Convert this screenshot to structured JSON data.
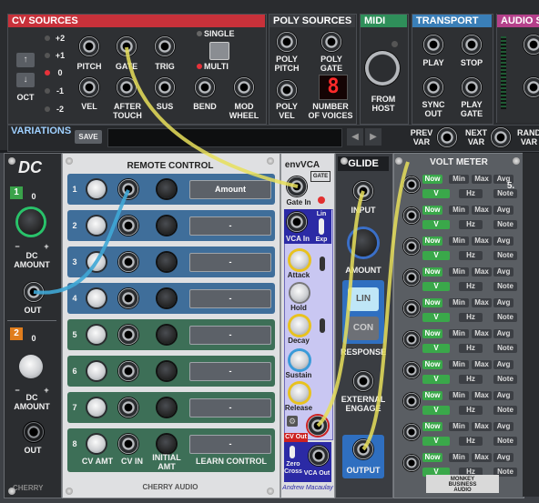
{
  "cv_sources": {
    "title": "CV SOURCES",
    "oct_values": [
      "+2",
      "+1",
      "0",
      "-1",
      "-2"
    ],
    "oct_label": "OCT",
    "jacks_row1": [
      "PITCH",
      "GATE",
      "TRIG"
    ],
    "jacks_row2": [
      "VEL",
      "AFTER\nTOUCH",
      "SUS",
      "BEND",
      "MOD\nWHEEL"
    ],
    "mode_single": "SINGLE",
    "mode_multi": "MULTI"
  },
  "poly_sources": {
    "title": "POLY SOURCES",
    "pitch": "POLY\nPITCH",
    "gate": "POLY\nGATE",
    "vel": "POLY\nVEL",
    "voices_label": "NUMBER\nOF VOICES",
    "voices_value": "8"
  },
  "midi": {
    "title": "MIDI",
    "from_host": "FROM\nHOST"
  },
  "transport": {
    "title": "TRANSPORT",
    "play": "PLAY",
    "stop": "STOP",
    "sync_out": "SYNC\nOUT",
    "play_gate": "PLAY\nGATE"
  },
  "audio": {
    "title": "AUDIO S"
  },
  "variations": {
    "title": "VARIATIONS",
    "save": "SAVE",
    "prev": "PREV\nVAR",
    "next": "NEXT\nVAR",
    "rand": "RAND\nVAR"
  },
  "dc": {
    "title": "DC",
    "ch1": "1",
    "ch2": "2",
    "value_zero": "0",
    "minus": "−",
    "plus": "+",
    "amount_label": "DC\nAMOUNT",
    "out_label": "OUT",
    "brand": "CHERRY"
  },
  "remote_control": {
    "title": "REMOTE CONTROL",
    "rows": [
      {
        "n": "1",
        "lcd": "Amount"
      },
      {
        "n": "2",
        "lcd": "-"
      },
      {
        "n": "3",
        "lcd": "-"
      },
      {
        "n": "4",
        "lcd": "-"
      },
      {
        "n": "5",
        "lcd": "-"
      },
      {
        "n": "6",
        "lcd": "-"
      },
      {
        "n": "7",
        "lcd": "-"
      },
      {
        "n": "8",
        "lcd": "-"
      }
    ],
    "footer_cv_amt": "CV AMT",
    "footer_cv_in": "CV IN",
    "footer_initial": "INITIAL\nAMT",
    "footer_learn": "LEARN CONTROL",
    "brand": "CHERRY AUDIO"
  },
  "envvca": {
    "title": "envVCA",
    "gate": "GATE",
    "gate_in": "Gate In",
    "vca_in": "VCA In",
    "lin": "Lin",
    "exp": "Exp",
    "attack": "Attack",
    "hold": "Hold",
    "decay": "Decay",
    "sustain": "Sustain",
    "release": "Release",
    "cv_out": "CV Out",
    "zero_cross": "Zero\nCross",
    "vca_out": "VCA Out",
    "author": "Andrew Macaulay"
  },
  "glide": {
    "title": "GLIDE",
    "input": "INPUT",
    "amount": "AMOUNT",
    "lin": "LIN",
    "con": "CON",
    "response": "RESPONSE",
    "external": "EXTERNAL\nENGAGE",
    "output": "OUTPUT"
  },
  "volt_meter": {
    "title": "VOLT METER",
    "row_labels_top": [
      "Now",
      "Min",
      "Max",
      "Avg"
    ],
    "row_labels_bottom": [
      "V",
      "Hz",
      "Note"
    ],
    "first_value": "5.",
    "brand": "MONKEY\nBUSINESS\nAUDIO"
  },
  "colors": {
    "cv_red": "#c8313a",
    "poly_gray": "#2c2e31",
    "transport_blue": "#3a7fb8",
    "midi_green": "#2f8f5a",
    "remote_blue": "#3f6e9a",
    "remote_green": "#3d6f57",
    "env_lavender": "#c9c7f2",
    "cable_yellow": "#e8df5a",
    "cable_blue": "#3fa7d6"
  }
}
